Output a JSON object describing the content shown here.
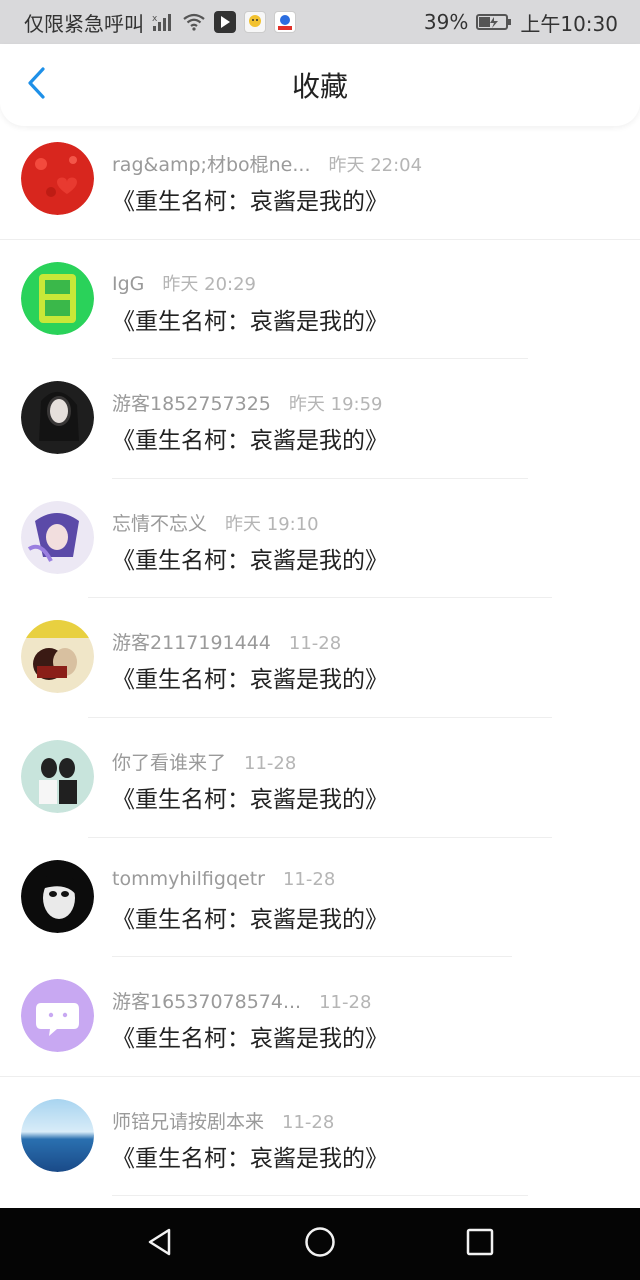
{
  "status_bar": {
    "carrier": "仅限紧急呼叫",
    "battery": "39%",
    "time": "上午10:30",
    "icons": [
      "signal-icon",
      "wifi-icon",
      "app-icon-video",
      "app-icon-qq",
      "app-icon-baidu",
      "battery-icon"
    ]
  },
  "header": {
    "title": "收藏",
    "back_icon": "chevron-left-icon"
  },
  "items": [
    {
      "user": "rag&amp;材bo棍ne...",
      "time": "昨天 22:04",
      "text": "《重生名柯：哀酱是我的》",
      "avatar_color": "#d8261e"
    },
    {
      "user": "IgG",
      "time": "昨天 20:29",
      "text": "《重生名柯：哀酱是我的》",
      "avatar_color": "#3fd04a"
    },
    {
      "user": "游客1852757325",
      "time": "昨天 19:59",
      "text": "《重生名柯：哀酱是我的》",
      "avatar_color": "#2a2a2a"
    },
    {
      "user": "忘情不忘义",
      "time": "昨天 19:10",
      "text": "《重生名柯：哀酱是我的》",
      "avatar_color": "#7b6fb0"
    },
    {
      "user": "游客2117191444",
      "time": "11-28",
      "text": "《重生名柯：哀酱是我的》",
      "avatar_color": "#8a4a2a"
    },
    {
      "user": "你了看谁来了",
      "time": "11-28",
      "text": "《重生名柯：哀酱是我的》",
      "avatar_color": "#b8d8d0"
    },
    {
      "user": "tommyhilfigqetr",
      "time": "11-28",
      "text": "《重生名柯：哀酱是我的》",
      "avatar_color": "#111111"
    },
    {
      "user": "游客16537078574...",
      "time": "11-28",
      "text": "《重生名柯：哀酱是我的》",
      "avatar_color": "#c7a8f0"
    },
    {
      "user": "师锫兄请按剧本来",
      "time": "11-28",
      "text": "《重生名柯：哀酱是我的》",
      "avatar_color": "#4a90c8"
    }
  ],
  "nav_bar": {
    "back": "triangle-back-icon",
    "home": "circle-home-icon",
    "recents": "square-recents-icon"
  }
}
